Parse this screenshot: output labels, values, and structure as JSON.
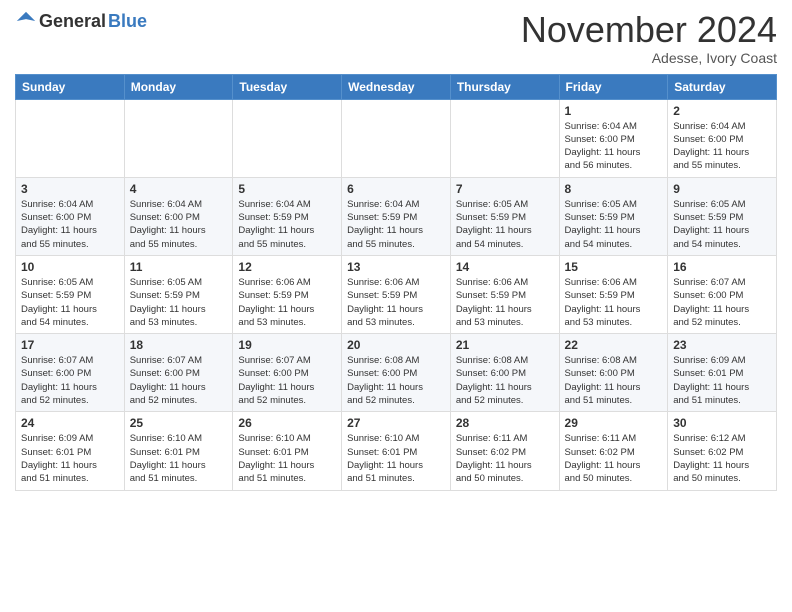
{
  "header": {
    "logo_general": "General",
    "logo_blue": "Blue",
    "month_title": "November 2024",
    "location": "Adesse, Ivory Coast"
  },
  "weekdays": [
    "Sunday",
    "Monday",
    "Tuesday",
    "Wednesday",
    "Thursday",
    "Friday",
    "Saturday"
  ],
  "weeks": [
    [
      {
        "day": "",
        "info": ""
      },
      {
        "day": "",
        "info": ""
      },
      {
        "day": "",
        "info": ""
      },
      {
        "day": "",
        "info": ""
      },
      {
        "day": "",
        "info": ""
      },
      {
        "day": "1",
        "info": "Sunrise: 6:04 AM\nSunset: 6:00 PM\nDaylight: 11 hours\nand 56 minutes."
      },
      {
        "day": "2",
        "info": "Sunrise: 6:04 AM\nSunset: 6:00 PM\nDaylight: 11 hours\nand 55 minutes."
      }
    ],
    [
      {
        "day": "3",
        "info": "Sunrise: 6:04 AM\nSunset: 6:00 PM\nDaylight: 11 hours\nand 55 minutes."
      },
      {
        "day": "4",
        "info": "Sunrise: 6:04 AM\nSunset: 6:00 PM\nDaylight: 11 hours\nand 55 minutes."
      },
      {
        "day": "5",
        "info": "Sunrise: 6:04 AM\nSunset: 5:59 PM\nDaylight: 11 hours\nand 55 minutes."
      },
      {
        "day": "6",
        "info": "Sunrise: 6:04 AM\nSunset: 5:59 PM\nDaylight: 11 hours\nand 55 minutes."
      },
      {
        "day": "7",
        "info": "Sunrise: 6:05 AM\nSunset: 5:59 PM\nDaylight: 11 hours\nand 54 minutes."
      },
      {
        "day": "8",
        "info": "Sunrise: 6:05 AM\nSunset: 5:59 PM\nDaylight: 11 hours\nand 54 minutes."
      },
      {
        "day": "9",
        "info": "Sunrise: 6:05 AM\nSunset: 5:59 PM\nDaylight: 11 hours\nand 54 minutes."
      }
    ],
    [
      {
        "day": "10",
        "info": "Sunrise: 6:05 AM\nSunset: 5:59 PM\nDaylight: 11 hours\nand 54 minutes."
      },
      {
        "day": "11",
        "info": "Sunrise: 6:05 AM\nSunset: 5:59 PM\nDaylight: 11 hours\nand 53 minutes."
      },
      {
        "day": "12",
        "info": "Sunrise: 6:06 AM\nSunset: 5:59 PM\nDaylight: 11 hours\nand 53 minutes."
      },
      {
        "day": "13",
        "info": "Sunrise: 6:06 AM\nSunset: 5:59 PM\nDaylight: 11 hours\nand 53 minutes."
      },
      {
        "day": "14",
        "info": "Sunrise: 6:06 AM\nSunset: 5:59 PM\nDaylight: 11 hours\nand 53 minutes."
      },
      {
        "day": "15",
        "info": "Sunrise: 6:06 AM\nSunset: 5:59 PM\nDaylight: 11 hours\nand 53 minutes."
      },
      {
        "day": "16",
        "info": "Sunrise: 6:07 AM\nSunset: 6:00 PM\nDaylight: 11 hours\nand 52 minutes."
      }
    ],
    [
      {
        "day": "17",
        "info": "Sunrise: 6:07 AM\nSunset: 6:00 PM\nDaylight: 11 hours\nand 52 minutes."
      },
      {
        "day": "18",
        "info": "Sunrise: 6:07 AM\nSunset: 6:00 PM\nDaylight: 11 hours\nand 52 minutes."
      },
      {
        "day": "19",
        "info": "Sunrise: 6:07 AM\nSunset: 6:00 PM\nDaylight: 11 hours\nand 52 minutes."
      },
      {
        "day": "20",
        "info": "Sunrise: 6:08 AM\nSunset: 6:00 PM\nDaylight: 11 hours\nand 52 minutes."
      },
      {
        "day": "21",
        "info": "Sunrise: 6:08 AM\nSunset: 6:00 PM\nDaylight: 11 hours\nand 52 minutes."
      },
      {
        "day": "22",
        "info": "Sunrise: 6:08 AM\nSunset: 6:00 PM\nDaylight: 11 hours\nand 51 minutes."
      },
      {
        "day": "23",
        "info": "Sunrise: 6:09 AM\nSunset: 6:01 PM\nDaylight: 11 hours\nand 51 minutes."
      }
    ],
    [
      {
        "day": "24",
        "info": "Sunrise: 6:09 AM\nSunset: 6:01 PM\nDaylight: 11 hours\nand 51 minutes."
      },
      {
        "day": "25",
        "info": "Sunrise: 6:10 AM\nSunset: 6:01 PM\nDaylight: 11 hours\nand 51 minutes."
      },
      {
        "day": "26",
        "info": "Sunrise: 6:10 AM\nSunset: 6:01 PM\nDaylight: 11 hours\nand 51 minutes."
      },
      {
        "day": "27",
        "info": "Sunrise: 6:10 AM\nSunset: 6:01 PM\nDaylight: 11 hours\nand 51 minutes."
      },
      {
        "day": "28",
        "info": "Sunrise: 6:11 AM\nSunset: 6:02 PM\nDaylight: 11 hours\nand 50 minutes."
      },
      {
        "day": "29",
        "info": "Sunrise: 6:11 AM\nSunset: 6:02 PM\nDaylight: 11 hours\nand 50 minutes."
      },
      {
        "day": "30",
        "info": "Sunrise: 6:12 AM\nSunset: 6:02 PM\nDaylight: 11 hours\nand 50 minutes."
      }
    ]
  ]
}
